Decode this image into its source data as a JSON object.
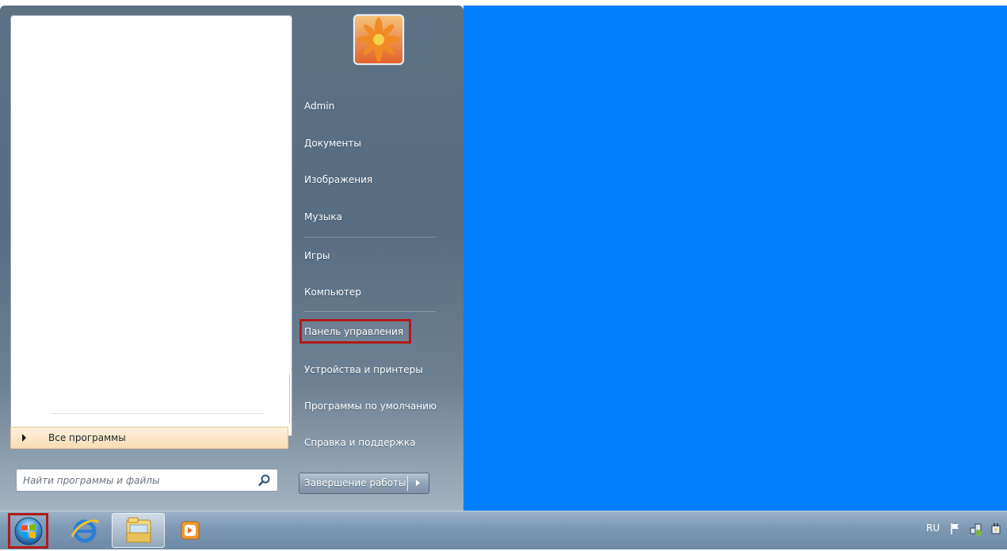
{
  "start_menu": {
    "right_items": [
      {
        "label": "Admin"
      },
      {
        "label": "Документы"
      },
      {
        "label": "Изображения"
      },
      {
        "label": "Музыка"
      },
      {
        "label": "Игры"
      },
      {
        "label": "Компьютер"
      },
      {
        "label": "Панель управления",
        "highlighted": true
      },
      {
        "label": "Устройства и принтеры"
      },
      {
        "label": "Программы по умолчанию"
      },
      {
        "label": "Справка и поддержка"
      }
    ],
    "all_programs_label": "Все программы",
    "search": {
      "placeholder": "Найти программы и файлы",
      "value": ""
    },
    "shutdown_label": "Завершение работы",
    "highlight_color": "#b11a1a"
  },
  "taskbar": {
    "pinned": [
      {
        "icon": "internet-explorer-icon"
      },
      {
        "icon": "windows-explorer-icon",
        "active": true
      },
      {
        "icon": "media-player-icon"
      }
    ],
    "start_button_highlighted": true,
    "tray": {
      "language": "RU",
      "icons": [
        "flag-icon",
        "network-icon",
        "power-icon"
      ]
    }
  },
  "desktop": {
    "background_color": "#0080ff"
  }
}
